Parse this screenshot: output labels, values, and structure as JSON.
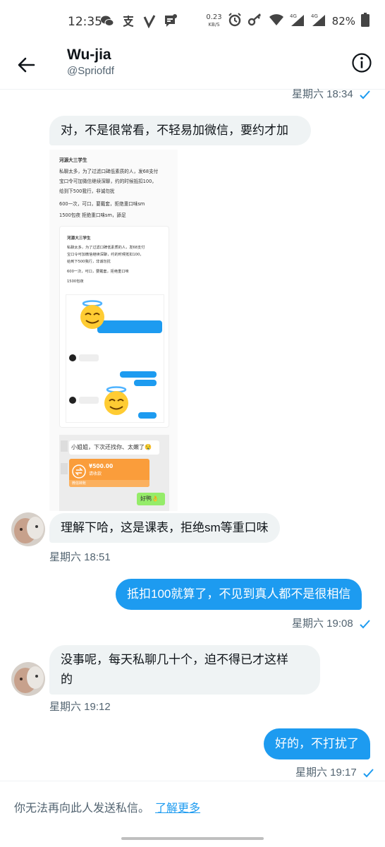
{
  "status_bar": {
    "time": "12:35",
    "netspeed_value": "0.23",
    "netspeed_unit": "KB/S",
    "battery": "82%",
    "left_icons": [
      "wechat-icon",
      "alipay-icon",
      "v-app-icon",
      "message-icon"
    ],
    "right_icons": [
      "alarm-icon",
      "key-icon",
      "wifi-icon",
      "signal-4g-icon",
      "signal-4g-icon",
      "battery-icon"
    ]
  },
  "header": {
    "name": "Wu-jia",
    "handle": "@Spriofdf"
  },
  "messages": [
    {
      "direction": "out",
      "timestamp": "星期六 18:34",
      "read": true
    },
    {
      "direction": "in",
      "text": "对，不是很常看，不轻易加微信，要约才加"
    },
    {
      "direction": "in",
      "type": "image"
    },
    {
      "direction": "in",
      "text": "理解下哈，这是课表，拒绝sm等重口味",
      "timestamp": "星期六 18:51"
    },
    {
      "direction": "out",
      "text": "抵扣100就算了，不见到真人都不是很相信",
      "timestamp": "星期六 19:08",
      "read": true
    },
    {
      "direction": "in",
      "text_line1": "没事呢，每天私聊几十个，迫不得已才这样",
      "text_line2": "的",
      "timestamp": "星期六 19:12"
    },
    {
      "direction": "out",
      "text": "好的，不打扰了",
      "timestamp": "星期六 19:17",
      "read": true
    }
  ],
  "image_content": {
    "title": "河源大三学生",
    "para1_l1": "私聊太多，为了过滤口碑低素质的人，发68支付",
    "para1_l2": "宝口令可加微信继续深聊，约的时候抵扣100，",
    "para1_l3": "给到下500我行，非诚勿扰",
    "para2": "600一次，可口，要戴套，拒绝重口味sm",
    "para3": "1500包夜 拒绝重口味sm，舔足",
    "inner_title": "河源大三学生",
    "inner_l1": "私聊太多，为了过滤口碑低素质的人，发68支付",
    "inner_l2": "宝口令可加微信继续深聊，约的时候抵扣100，",
    "inner_l3": "给到下500我行，非诚勿扰",
    "inner_l4": "600一次，可口，要戴套，拒绝重口味",
    "inner_l5": "1500包夜",
    "chat_text": "小姐姐，下次还找你、太嫩了🤤",
    "payment_amount": "¥500.00",
    "payment_label": "请收款",
    "payment_footer": "微信转账",
    "reply": "好鸭👌"
  },
  "footer": {
    "notice": "你无法再向此人发送私信。",
    "link": "了解更多"
  },
  "colors": {
    "accent": "#1d9bf0",
    "bubble_in": "#eff3f4",
    "secondary_text": "#536471"
  }
}
